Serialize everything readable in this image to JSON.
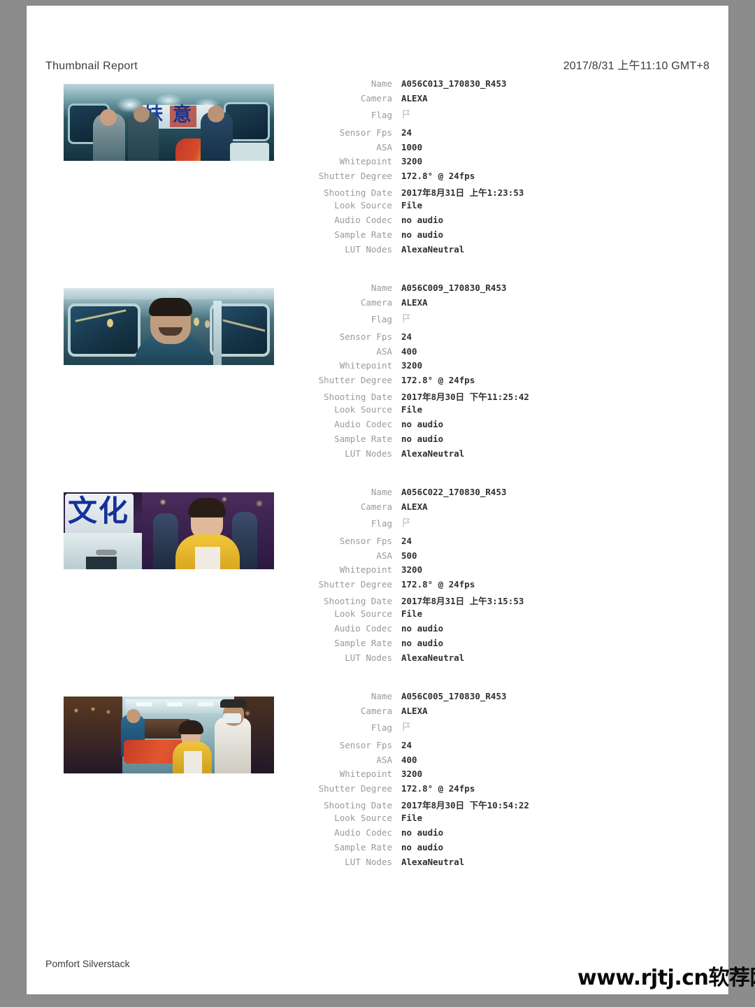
{
  "header": {
    "title": "Thumbnail Report",
    "date": "2017/8/31 上午11:10 GMT+8"
  },
  "labels": {
    "name": "Name",
    "camera": "Camera",
    "flag": "Flag",
    "sensor_fps": "Sensor Fps",
    "asa": "ASA",
    "whitepoint": "Whitepoint",
    "shutter_degree": "Shutter Degree",
    "shooting_date": "Shooting Date",
    "look_source": "Look Source",
    "audio_codec": "Audio Codec",
    "sample_rate": "Sample Rate",
    "lut_nodes": "LUT Nodes"
  },
  "clips": [
    {
      "name": "A056C013_170830_R453",
      "camera": "ALEXA",
      "flag": "flag-icon",
      "sensor_fps": "24",
      "asa": "1000",
      "whitepoint": "3200",
      "shutter_degree": "172.8° @ 24fps",
      "shooting_date": "2017年8月31日 上午1:23:53",
      "look_source": "File",
      "audio_codec": "no audio",
      "sample_rate": "no audio",
      "lut_nodes": "AlexaNeutral"
    },
    {
      "name": "A056C009_170830_R453",
      "camera": "ALEXA",
      "flag": "flag-icon",
      "sensor_fps": "24",
      "asa": "400",
      "whitepoint": "3200",
      "shutter_degree": "172.8° @ 24fps",
      "shooting_date": "2017年8月30日 下午11:25:42",
      "look_source": "File",
      "audio_codec": "no audio",
      "sample_rate": "no audio",
      "lut_nodes": "AlexaNeutral"
    },
    {
      "name": "A056C022_170830_R453",
      "camera": "ALEXA",
      "flag": "flag-icon",
      "sensor_fps": "24",
      "asa": "500",
      "whitepoint": "3200",
      "shutter_degree": "172.8° @ 24fps",
      "shooting_date": "2017年8月31日 上午3:15:53",
      "look_source": "File",
      "audio_codec": "no audio",
      "sample_rate": "no audio",
      "lut_nodes": "AlexaNeutral"
    },
    {
      "name": "A056C005_170830_R453",
      "camera": "ALEXA",
      "flag": "flag-icon",
      "sensor_fps": "24",
      "asa": "400",
      "whitepoint": "3200",
      "shutter_degree": "172.8° @ 24fps",
      "shooting_date": "2017年8月30日 下午10:54:22",
      "look_source": "File",
      "audio_codec": "no audio",
      "sample_rate": "no audio",
      "lut_nodes": "AlexaNeutral"
    }
  ],
  "footer": {
    "application": "Pomfort Silverstack"
  },
  "watermark": {
    "text": "www.rjtj.cn软荐网"
  },
  "colors": {
    "page_background": "#8c8c8d",
    "paper": "#ffffff",
    "label_text": "#9a9a9d",
    "value_text": "#2f2f31",
    "heading_text": "#3b3b3d"
  }
}
